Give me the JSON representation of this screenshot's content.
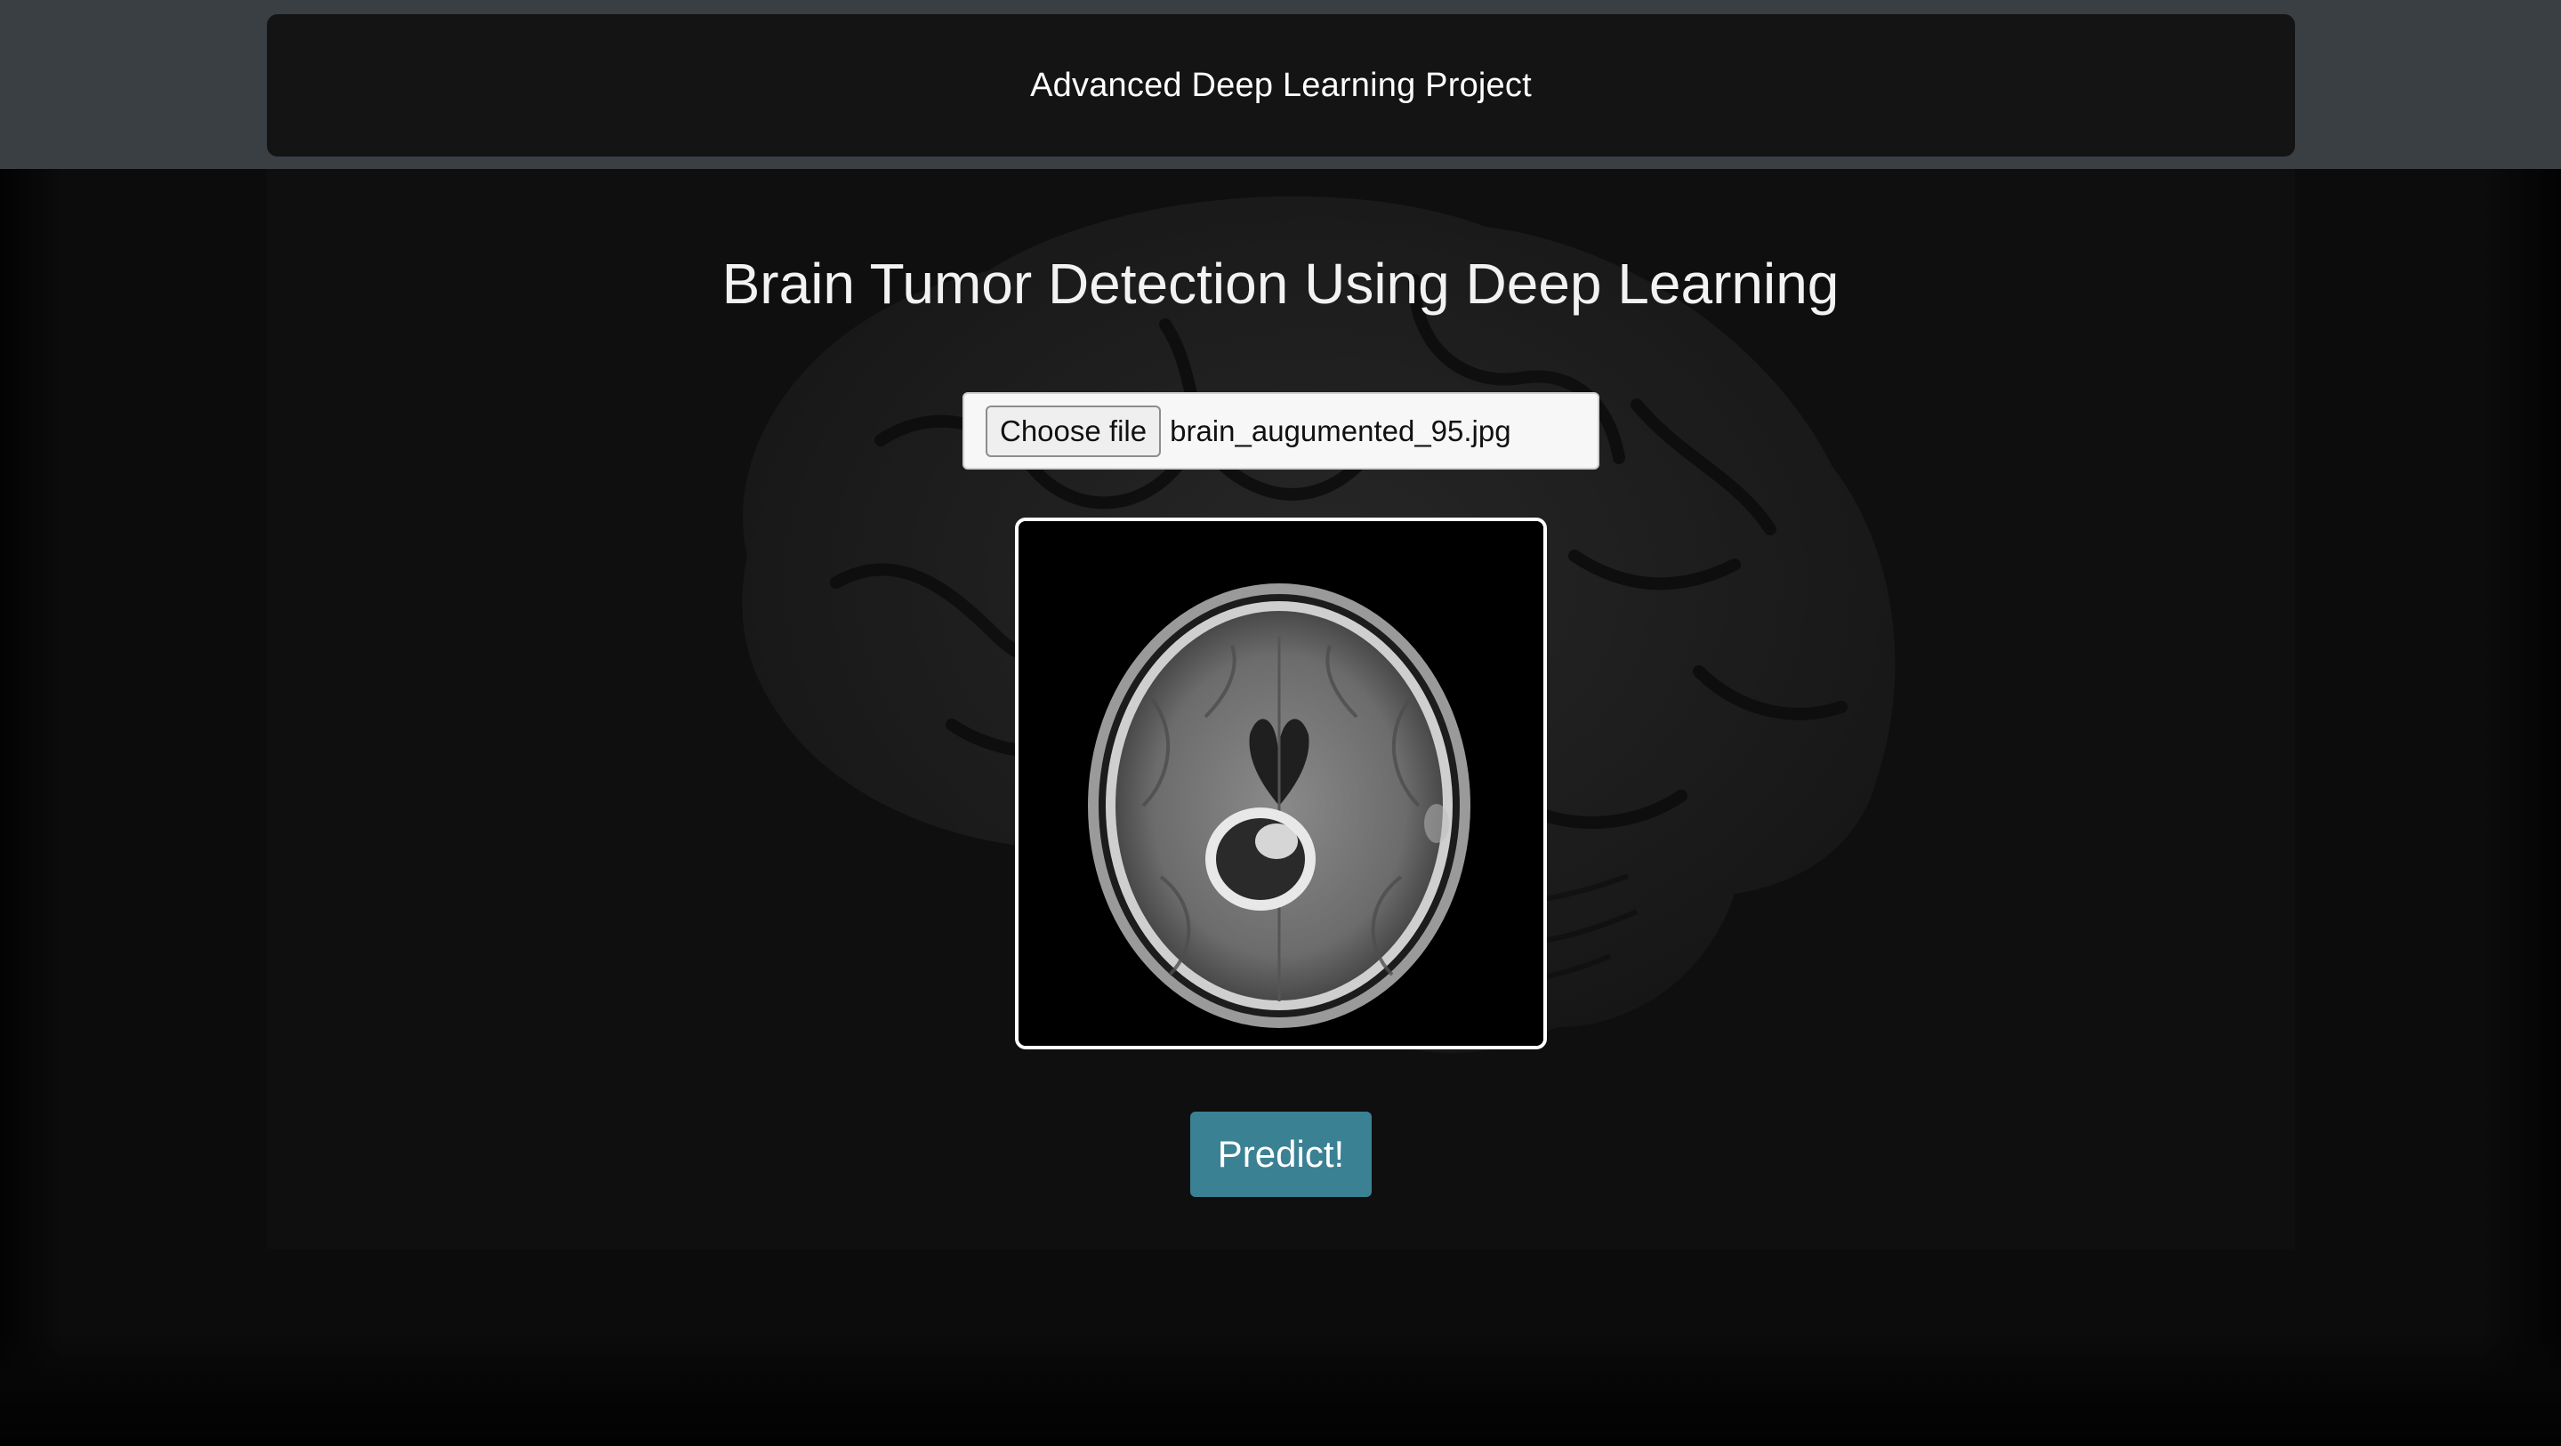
{
  "navbar": {
    "brand": "Advanced Deep Learning Project"
  },
  "main": {
    "title": "Brain Tumor Detection Using Deep Learning",
    "file_input": {
      "button_label": "Choose file",
      "file_name": "brain_augumented_95.jpg"
    },
    "preview_image": "mri-brain-scan",
    "predict_button": "Predict!"
  },
  "colors": {
    "topbar": "#3a3f44",
    "navbar": "#141414",
    "background": "#0c0c0c",
    "predict_button": "#3b8194"
  }
}
